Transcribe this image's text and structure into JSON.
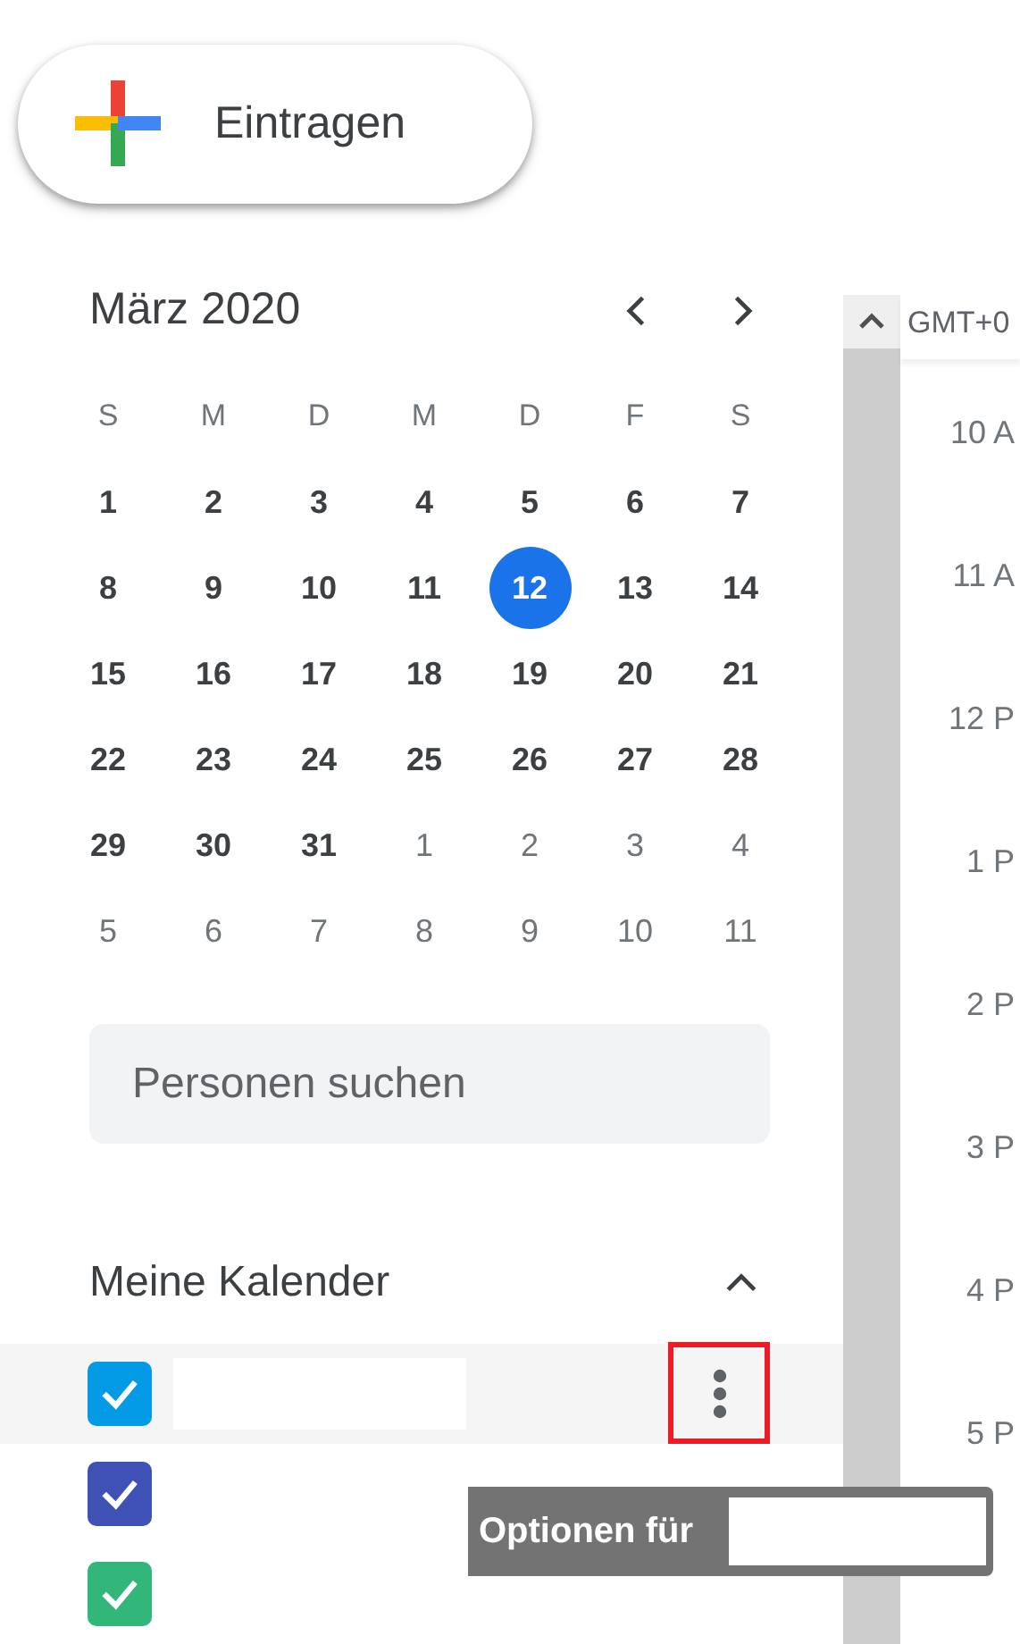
{
  "create_button": {
    "label": "Eintragen"
  },
  "mini_calendar": {
    "title": "März 2020",
    "weekdays": [
      "S",
      "M",
      "D",
      "M",
      "D",
      "F",
      "S"
    ],
    "weeks": [
      [
        {
          "day": "1",
          "outside": false,
          "selected": false
        },
        {
          "day": "2",
          "outside": false,
          "selected": false
        },
        {
          "day": "3",
          "outside": false,
          "selected": false
        },
        {
          "day": "4",
          "outside": false,
          "selected": false
        },
        {
          "day": "5",
          "outside": false,
          "selected": false
        },
        {
          "day": "6",
          "outside": false,
          "selected": false
        },
        {
          "day": "7",
          "outside": false,
          "selected": false
        }
      ],
      [
        {
          "day": "8",
          "outside": false,
          "selected": false
        },
        {
          "day": "9",
          "outside": false,
          "selected": false
        },
        {
          "day": "10",
          "outside": false,
          "selected": false
        },
        {
          "day": "11",
          "outside": false,
          "selected": false
        },
        {
          "day": "12",
          "outside": false,
          "selected": true
        },
        {
          "day": "13",
          "outside": false,
          "selected": false
        },
        {
          "day": "14",
          "outside": false,
          "selected": false
        }
      ],
      [
        {
          "day": "15",
          "outside": false,
          "selected": false
        },
        {
          "day": "16",
          "outside": false,
          "selected": false
        },
        {
          "day": "17",
          "outside": false,
          "selected": false
        },
        {
          "day": "18",
          "outside": false,
          "selected": false
        },
        {
          "day": "19",
          "outside": false,
          "selected": false
        },
        {
          "day": "20",
          "outside": false,
          "selected": false
        },
        {
          "day": "21",
          "outside": false,
          "selected": false
        }
      ],
      [
        {
          "day": "22",
          "outside": false,
          "selected": false
        },
        {
          "day": "23",
          "outside": false,
          "selected": false
        },
        {
          "day": "24",
          "outside": false,
          "selected": false
        },
        {
          "day": "25",
          "outside": false,
          "selected": false
        },
        {
          "day": "26",
          "outside": false,
          "selected": false
        },
        {
          "day": "27",
          "outside": false,
          "selected": false
        },
        {
          "day": "28",
          "outside": false,
          "selected": false
        }
      ],
      [
        {
          "day": "29",
          "outside": false,
          "selected": false
        },
        {
          "day": "30",
          "outside": false,
          "selected": false
        },
        {
          "day": "31",
          "outside": false,
          "selected": false
        },
        {
          "day": "1",
          "outside": true,
          "selected": false
        },
        {
          "day": "2",
          "outside": true,
          "selected": false
        },
        {
          "day": "3",
          "outside": true,
          "selected": false
        },
        {
          "day": "4",
          "outside": true,
          "selected": false
        }
      ],
      [
        {
          "day": "5",
          "outside": true,
          "selected": false
        },
        {
          "day": "6",
          "outside": true,
          "selected": false
        },
        {
          "day": "7",
          "outside": true,
          "selected": false
        },
        {
          "day": "8",
          "outside": true,
          "selected": false
        },
        {
          "day": "9",
          "outside": true,
          "selected": false
        },
        {
          "day": "10",
          "outside": true,
          "selected": false
        },
        {
          "day": "11",
          "outside": true,
          "selected": false
        }
      ]
    ]
  },
  "people_search": {
    "placeholder": "Personen suchen"
  },
  "my_calendars": {
    "title": "Meine Kalender",
    "expanded": true,
    "items": [
      {
        "checked": true,
        "color": "#039be5",
        "hovered": true
      },
      {
        "checked": true,
        "color": "#3f51b5",
        "hovered": false
      },
      {
        "checked": true,
        "color": "#33b679",
        "hovered": false
      }
    ]
  },
  "tooltip": {
    "text": "Optionen für"
  },
  "time_grid": {
    "timezone": "GMT+0",
    "hours": [
      "10 A",
      "11 A",
      "12 P",
      "1 P",
      "2 P",
      "3 P",
      "4 P",
      "5 P"
    ]
  }
}
